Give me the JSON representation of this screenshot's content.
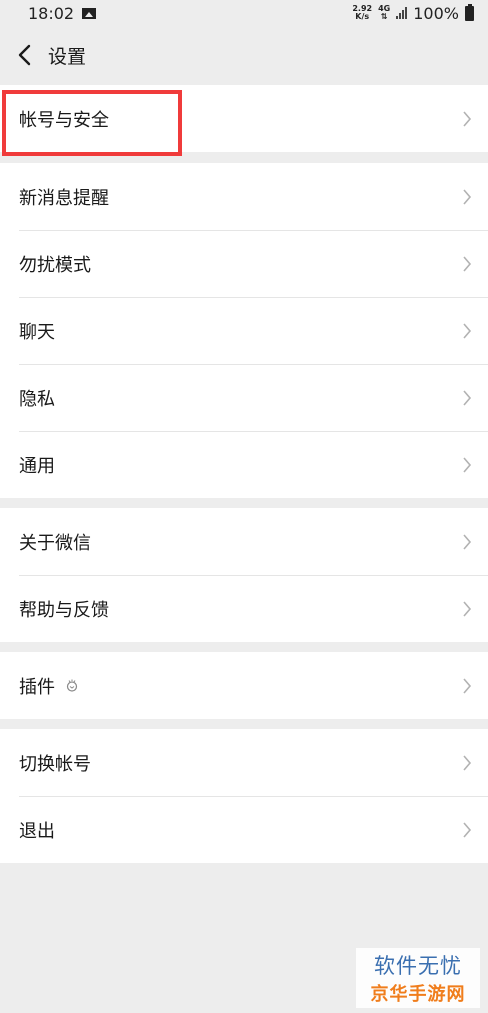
{
  "status_bar": {
    "time": "18:02",
    "speed_value": "2.92",
    "speed_unit": "K/s",
    "network_type": "4G",
    "battery": "100%"
  },
  "header": {
    "title": "设置"
  },
  "groups": [
    {
      "items": [
        {
          "label": "帐号与安全"
        }
      ]
    },
    {
      "items": [
        {
          "label": "新消息提醒"
        },
        {
          "label": "勿扰模式"
        },
        {
          "label": "聊天"
        },
        {
          "label": "隐私"
        },
        {
          "label": "通用"
        }
      ]
    },
    {
      "items": [
        {
          "label": "关于微信"
        },
        {
          "label": "帮助与反馈"
        }
      ]
    },
    {
      "items": [
        {
          "label": "插件"
        }
      ]
    },
    {
      "items": [
        {
          "label": "切换帐号"
        },
        {
          "label": "退出"
        }
      ]
    }
  ],
  "watermark": {
    "line1": "软件无忧",
    "line2": "京华手游网"
  },
  "colors": {
    "background": "#ededed",
    "card": "#ffffff",
    "highlight": "#f03b3b"
  }
}
